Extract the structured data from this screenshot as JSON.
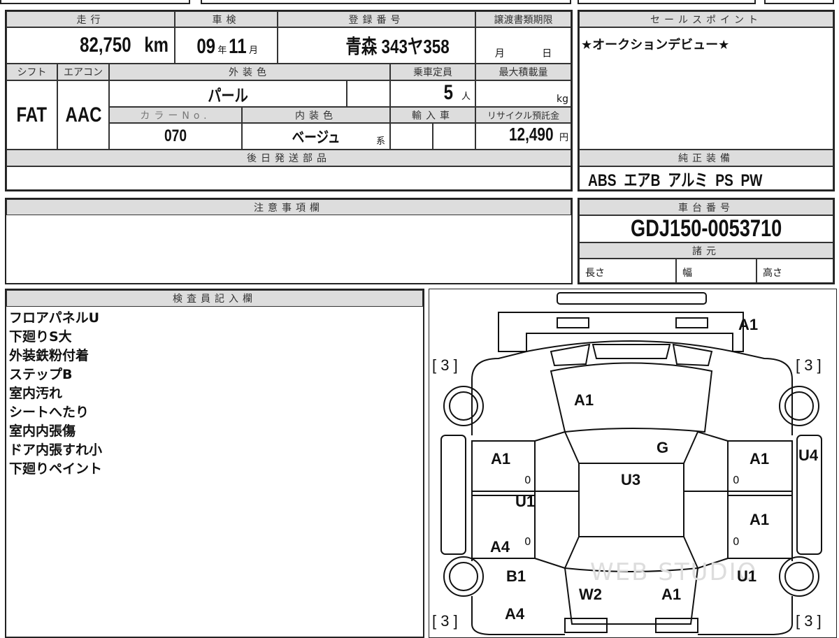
{
  "main": {
    "mileage_h": "走行",
    "mileage": "82,750",
    "mileage_unit": "km",
    "shaken_h": "車検",
    "shaken_year": "09",
    "year_unit": "年",
    "shaken_month": "11",
    "month_unit": "月",
    "reg_h": "登録番号",
    "reg": "青森 343ヤ358",
    "transfer_h": "譲渡書類期限",
    "transfer_month": "月",
    "transfer_day": "日",
    "shift_h": "シフト",
    "shift": "FAT",
    "ac_h": "エアコン",
    "ac": "AAC",
    "ext_color_h": "外装色",
    "ext_color": "パール",
    "capacity_h": "乗車定員",
    "capacity": "5",
    "capacity_unit": "人",
    "max_load_h": "最大積載量",
    "max_load_unit": "kg",
    "color_no_h": "カラーNo.",
    "color_no": "070",
    "int_color_h": "内装色",
    "int_color": "ベージュ",
    "int_color_suffix": "系",
    "import_h": "輸入車",
    "recycle_h": "リサイクル預託金",
    "recycle": "12,490",
    "recycle_unit": "円",
    "later_parts_h": "後日発送部品"
  },
  "sales": {
    "title": "セールスポイント",
    "text": "★オークションデビュー★"
  },
  "equipment": {
    "title": "純正装備",
    "text": "ABS  エアB  アルミ  PS  PW"
  },
  "notes": {
    "title": "注意事項欄"
  },
  "chassis": {
    "title": "車台番号",
    "number": "GDJ150-0053710",
    "spec_title": "諸元",
    "length": "長さ",
    "width": "幅",
    "height": "高さ"
  },
  "inspector": {
    "title": "検査員記入欄",
    "lines": [
      "フロアパネルU",
      "下廻りS大",
      "外装鉄粉付着",
      "ステップB",
      "室内汚れ",
      "シートへたり",
      "室内内張傷",
      "ドア内張すれ小",
      "下廻りペイント"
    ]
  },
  "diagram": {
    "marks": [
      "A1",
      "[ 3 ]",
      "[ 3 ]",
      "A1",
      "G",
      "A1",
      "U3",
      "A1",
      "U4",
      "U1",
      "A1",
      "A4",
      "B1",
      "U1",
      "W2",
      "A1",
      "A4",
      "[ 3 ]",
      "[ 3 ]"
    ],
    "zero": "0",
    "watermark": "WEB STUDIO"
  }
}
